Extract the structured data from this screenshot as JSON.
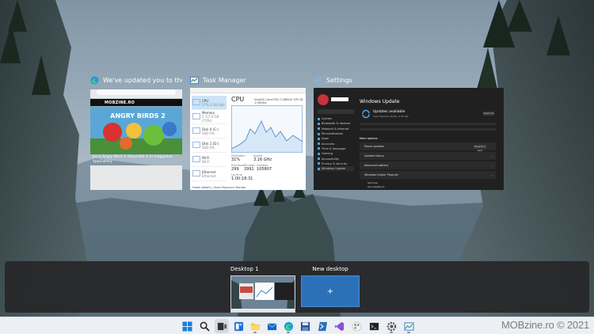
{
  "windows": [
    {
      "title": "We've updated you to the la...",
      "icon": "edge-icon"
    },
    {
      "title": "Task Manager",
      "icon": "task-manager-icon"
    },
    {
      "title": "Settings",
      "icon": "settings-gear-icon"
    }
  ],
  "edge_content": {
    "site_name": "MOBZINE.RO",
    "headline": "Jocul Angry Birds 2 disponibil și în magazinul AppGallery"
  },
  "task_manager": {
    "graph_label": "CPU",
    "processor": "Intel(R) Core(TM) i7-8650U CPU @ 1.90GHz",
    "sidebar": [
      {
        "name": "CPU",
        "detail": "27% 3.16 GHz"
      },
      {
        "name": "Memory",
        "detail": "5.7/7.9 GB (73%)"
      },
      {
        "name": "Disk 0 (C:)",
        "detail": "SSD 0%"
      },
      {
        "name": "Disk 1 (D:)",
        "detail": "SSD 0%"
      },
      {
        "name": "Wi-Fi",
        "detail": "Wi-Fi"
      },
      {
        "name": "Ethernet",
        "detail": "Ethernet"
      },
      {
        "name": "Ethernet",
        "detail": "Ethernet"
      }
    ],
    "stats": {
      "utilization": "31%",
      "speed": "3.16 GHz",
      "processes": "299",
      "threads": "2991",
      "handles": "105807",
      "uptime": "1:00:18:31"
    },
    "stat_labels": {
      "utilization": "Utilization",
      "speed": "Speed",
      "processes": "Processes",
      "threads": "Threads",
      "handles": "Handles",
      "uptime": "Up time"
    },
    "footer": "Fewer details  |  Open Resource Monitor"
  },
  "settings": {
    "heading": "Windows Update",
    "status_title": "Updates available",
    "status_sub": "Last checked: Today, 9:36 AM",
    "check_button": "Check now",
    "more_options": "More options",
    "nav_items": [
      "System",
      "Bluetooth & devices",
      "Network & internet",
      "Personalization",
      "Apps",
      "Accounts",
      "Time & language",
      "Gaming",
      "Accessibility",
      "Privacy & security",
      "Windows Update"
    ],
    "cards": [
      {
        "label": "Pause updates",
        "action": "Pause for 1 week"
      },
      {
        "label": "Update history",
        "action": ""
      },
      {
        "label": "Advanced options",
        "action": ""
      },
      {
        "label": "Windows Insider Program",
        "action": ""
      }
    ],
    "links": [
      "Get help",
      "Give feedback"
    ]
  },
  "desktops": {
    "desktop_1_label": "Desktop 1",
    "new_desktop_label": "New desktop",
    "new_desktop_symbol": "+"
  },
  "taskbar_icons": [
    "start-icon",
    "search-icon",
    "task-view-icon",
    "widgets-icon",
    "file-explorer-icon",
    "mail-icon",
    "edge-icon",
    "save-icon",
    "powershell-icon",
    "visual-studio-icon",
    "paint-icon",
    "terminal-icon",
    "settings-gear-icon",
    "task-manager-icon"
  ],
  "watermark": "MOBzine.ro © 2021"
}
